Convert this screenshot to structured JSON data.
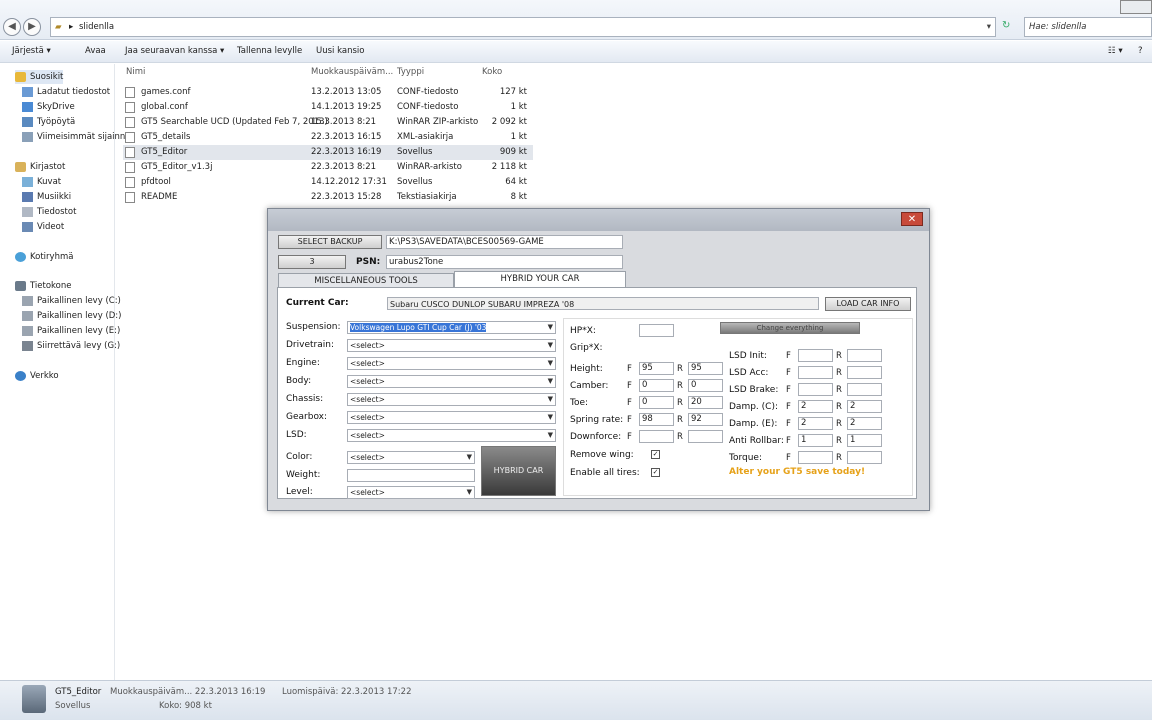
{
  "address": {
    "path": "slidenlla",
    "search_placeholder": "Hae: slidenlla"
  },
  "commands": [
    "Järjestä ▾",
    "Avaa",
    "Jaa seuraavan kanssa ▾",
    "Tallenna levylle",
    "Uusi kansio"
  ],
  "nav": {
    "items": [
      "Suosikit",
      "Ladatut tiedostot",
      "SkyDrive",
      "Työpöytä",
      "Viimeisimmät sijainnit",
      "Kirjastot",
      "Kuvat",
      "Musiikki",
      "Tiedostot",
      "Videot",
      "Kotiryhmä",
      "Tietokone",
      "Paikallinen levy (C:)",
      "Paikallinen levy (D:)",
      "Paikallinen levy (E:)",
      "Siirrettävä levy (G:)",
      "Verkko"
    ]
  },
  "files": {
    "headers": {
      "name": "Nimi",
      "modified": "Muokkauspäiväm...",
      "type": "Tyyppi",
      "size": "Koko"
    },
    "rows": [
      {
        "name": "games.conf",
        "date": "13.2.2013 13:05",
        "type": "CONF-tiedosto",
        "size": "127 kt"
      },
      {
        "name": "global.conf",
        "date": "14.1.2013 19:25",
        "type": "CONF-tiedosto",
        "size": "1 kt"
      },
      {
        "name": "GT5 Searchable UCD (Updated Feb 7, 2013)",
        "date": "15.3.2013 8:21",
        "type": "WinRAR ZIP-arkisto",
        "size": "2 092 kt"
      },
      {
        "name": "GT5_details",
        "date": "22.3.2013 16:15",
        "type": "XML-asiakirja",
        "size": "1 kt"
      },
      {
        "name": "GT5_Editor",
        "date": "22.3.2013 16:19",
        "type": "Sovellus",
        "size": "909 kt"
      },
      {
        "name": "GT5_Editor_v1.3j",
        "date": "22.3.2013 8:21",
        "type": "WinRAR-arkisto",
        "size": "2 118 kt"
      },
      {
        "name": "pfdtool",
        "date": "14.12.2012 17:31",
        "type": "Sovellus",
        "size": "64 kt"
      },
      {
        "name": "README",
        "date": "22.3.2013 15:28",
        "type": "Tekstiasiakirja",
        "size": "8 kt"
      }
    ]
  },
  "status": {
    "name": "GT5_Editor",
    "kind": "Sovellus",
    "modified": "Muokkauspäiväm... 22.3.2013 16:19",
    "created": "Luomispäivä: 22.3.2013 17:22",
    "size": "Koko: 908 kt"
  },
  "app": {
    "select_backup_label": "SELECT BACKUP",
    "backup_path": "K:\\PS3\\SAVEDATA\\BCES00569-GAME",
    "small_btn_label": "3",
    "psn_label": "PSN:",
    "psn_value": "urabus2Tone",
    "tab_misc": "MISCELLANEOUS TOOLS",
    "tab_hybrid": "HYBRID YOUR CAR",
    "current_car_label": "Current Car:",
    "current_car_value": "Subaru CUSCO DUNLOP SUBARU IMPREZA '08",
    "load_car_info": "LOAD CAR INFO",
    "parts": [
      {
        "label": "Suspension:",
        "value": "Volkswagen Lupo GTI Cup Car (J) '03"
      },
      {
        "label": "Drivetrain:",
        "value": "<select>"
      },
      {
        "label": "Engine:",
        "value": "<select>"
      },
      {
        "label": "Body:",
        "value": "<select>"
      },
      {
        "label": "Chassis:",
        "value": "<select>"
      },
      {
        "label": "Gearbox:",
        "value": "<select>"
      },
      {
        "label": "LSD:",
        "value": "<select>"
      }
    ],
    "color_label": "Color:",
    "color_value": "<select>",
    "weight_label": "Weight:",
    "level_label": "Level:",
    "level_value": "<select>",
    "hybrid_car_btn": "HYBRID CAR",
    "change_btn": "Change everything",
    "hp_label": "HP*X:",
    "grip_label": "Grip*X:",
    "tuning": [
      {
        "label": "Height:",
        "f": "95",
        "r": "95"
      },
      {
        "label": "Camber:",
        "f": "0",
        "r": "0"
      },
      {
        "label": "Toe:",
        "f": "0",
        "r": "20"
      },
      {
        "label": "Spring rate:",
        "f": "98",
        "r": "92"
      },
      {
        "label": "Downforce:",
        "f": "",
        "r": ""
      }
    ],
    "lsd": [
      {
        "label": "LSD Init:",
        "f": "",
        "r": ""
      },
      {
        "label": "LSD Acc:",
        "f": "",
        "r": ""
      },
      {
        "label": "LSD Brake:",
        "f": "",
        "r": ""
      },
      {
        "label": "Damp. (C):",
        "f": "2",
        "r": "2"
      },
      {
        "label": "Damp. (E):",
        "f": "2",
        "r": "2"
      },
      {
        "label": "Anti Rollbar:",
        "f": "1",
        "r": "1"
      },
      {
        "label": "Torque:",
        "f": "",
        "r": ""
      }
    ],
    "remove_wing": "Remove wing:",
    "enable_tires": "Enable all tires:",
    "promo": "Alter your GT5 save today!",
    "f_letter": "F",
    "r_letter": "R"
  }
}
